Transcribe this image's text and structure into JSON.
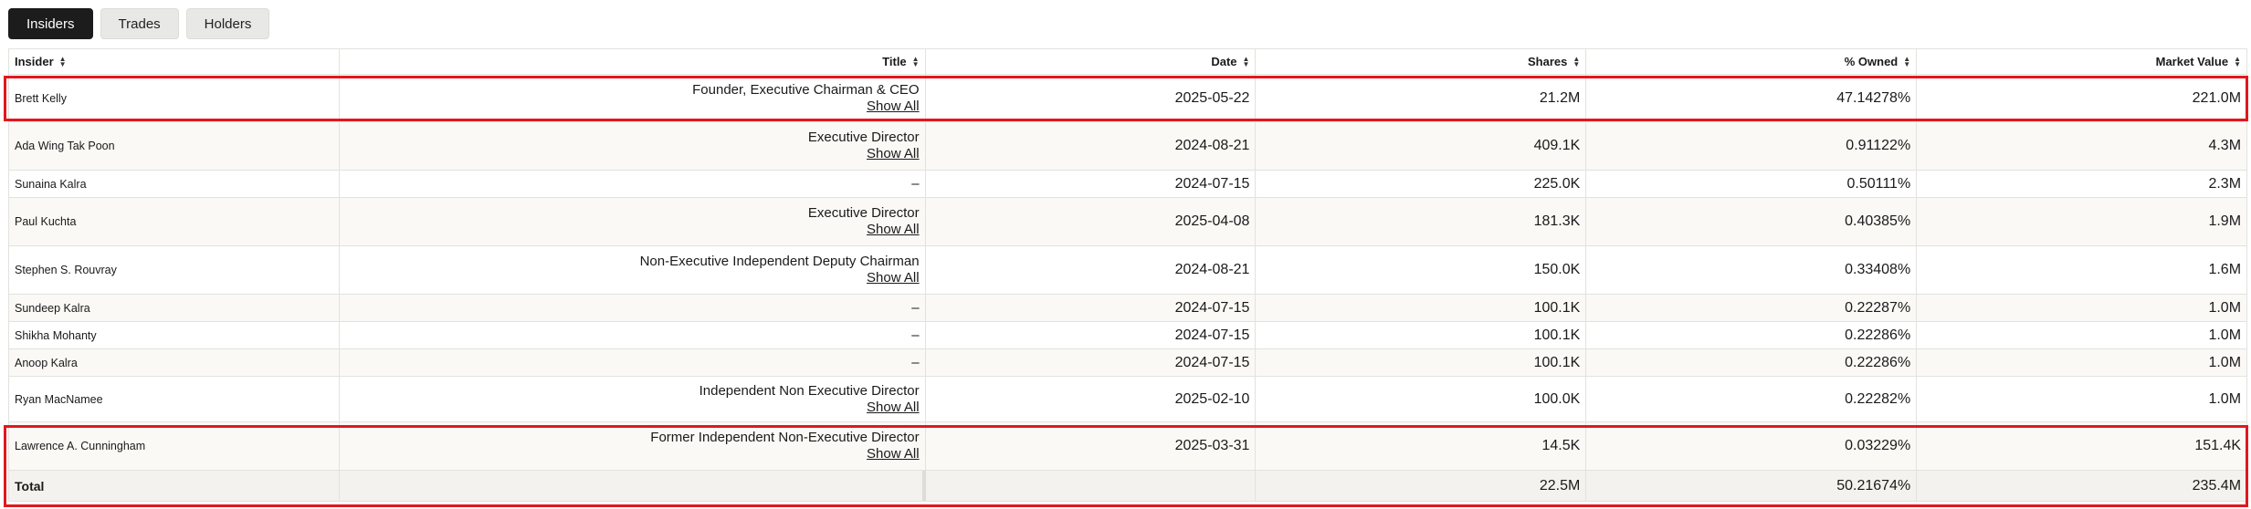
{
  "tabs": [
    {
      "label": "Insiders",
      "active": true
    },
    {
      "label": "Trades",
      "active": false
    },
    {
      "label": "Holders",
      "active": false
    }
  ],
  "columns": {
    "insider": "Insider",
    "title": "Title",
    "date": "Date",
    "shares": "Shares",
    "owned": "% Owned",
    "market_value": "Market Value"
  },
  "show_all_label": "Show All",
  "rows": [
    {
      "insider": "Brett Kelly",
      "title": "Founder, Executive Chairman & CEO",
      "date": "2025-05-22",
      "shares": "21.2M",
      "owned": "47.14278%",
      "market_value": "221.0M"
    },
    {
      "insider": "Ada Wing Tak Poon",
      "title": "Executive Director",
      "date": "2024-08-21",
      "shares": "409.1K",
      "owned": "0.91122%",
      "market_value": "4.3M"
    },
    {
      "insider": "Sunaina Kalra",
      "title": "–",
      "date": "2024-07-15",
      "shares": "225.0K",
      "owned": "0.50111%",
      "market_value": "2.3M"
    },
    {
      "insider": "Paul Kuchta",
      "title": "Executive Director",
      "date": "2025-04-08",
      "shares": "181.3K",
      "owned": "0.40385%",
      "market_value": "1.9M"
    },
    {
      "insider": "Stephen S. Rouvray",
      "title": "Non-Executive Independent Deputy Chairman",
      "date": "2024-08-21",
      "shares": "150.0K",
      "owned": "0.33408%",
      "market_value": "1.6M"
    },
    {
      "insider": "Sundeep Kalra",
      "title": "–",
      "date": "2024-07-15",
      "shares": "100.1K",
      "owned": "0.22287%",
      "market_value": "1.0M"
    },
    {
      "insider": "Shikha Mohanty",
      "title": "–",
      "date": "2024-07-15",
      "shares": "100.1K",
      "owned": "0.22286%",
      "market_value": "1.0M"
    },
    {
      "insider": "Anoop Kalra",
      "title": "–",
      "date": "2024-07-15",
      "shares": "100.1K",
      "owned": "0.22286%",
      "market_value": "1.0M"
    },
    {
      "insider": "Ryan MacNamee",
      "title": "Independent Non Executive Director",
      "date": "2025-02-10",
      "shares": "100.0K",
      "owned": "0.22282%",
      "market_value": "1.0M"
    },
    {
      "insider": "Lawrence A. Cunningham",
      "title": "Former Independent Non-Executive Director",
      "date": "2025-03-31",
      "shares": "14.5K",
      "owned": "0.03229%",
      "market_value": "151.4K"
    }
  ],
  "total": {
    "label": "Total",
    "shares": "22.5M",
    "owned": "50.21674%",
    "market_value": "235.4M"
  },
  "colors": {
    "highlight": "#e2171e",
    "tab_active_bg": "#1c1c1c",
    "row_alt_bg": "#faf9f6"
  }
}
